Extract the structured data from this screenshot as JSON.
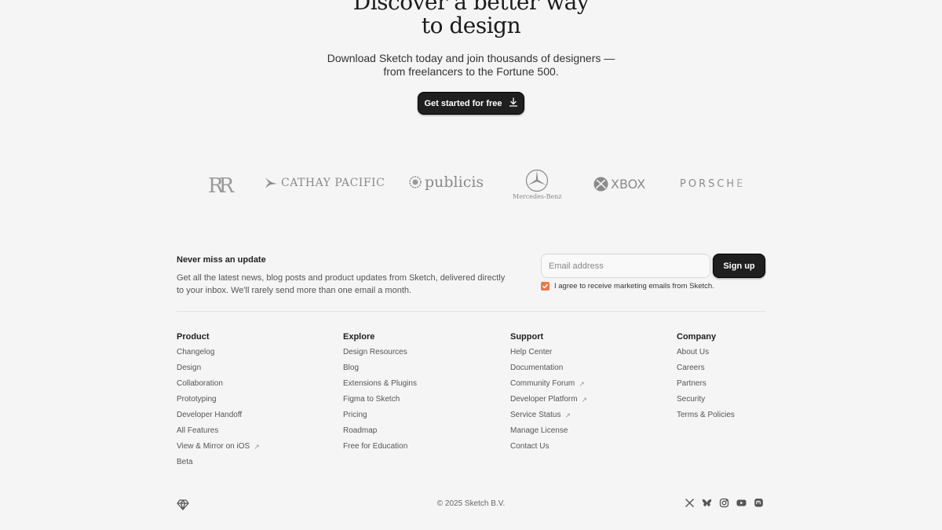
{
  "hero": {
    "title_line1": "Discover a better way",
    "title_line2": "to design",
    "subtitle_line1": "Download Sketch today and join thousands of designers —",
    "subtitle_line2": "from freelancers to the Fortune 500.",
    "cta_label": "Get started for free",
    "cta_icon": "download-icon"
  },
  "logos": {
    "rolls_royce": "RR",
    "cathay": "CATHAY PACIFIC",
    "publicis": "publicis",
    "mercedes": "Mercedes-Benz",
    "xbox": "XBOX",
    "porsche": "PORSCHE"
  },
  "newsletter": {
    "title": "Never miss an update",
    "description": "Get all the latest news, blog posts and product updates from Sketch, delivered directly to your inbox. We'll rarely send more than one email a month.",
    "email_placeholder": "Email address",
    "email_value": "",
    "signup_label": "Sign up",
    "agree_label": "I agree to receive marketing emails from Sketch.",
    "agree_checked": true,
    "accent_color": "#e9784a"
  },
  "footer": {
    "columns": [
      {
        "heading": "Product",
        "links": [
          {
            "label": "Changelog",
            "external": false
          },
          {
            "label": "Design",
            "external": false
          },
          {
            "label": "Collaboration",
            "external": false
          },
          {
            "label": "Prototyping",
            "external": false
          },
          {
            "label": "Developer Handoff",
            "external": false
          },
          {
            "label": "All Features",
            "external": false
          },
          {
            "label": "View & Mirror on iOS",
            "external": true
          },
          {
            "label": "Beta",
            "external": false
          }
        ]
      },
      {
        "heading": "Explore",
        "links": [
          {
            "label": "Design Resources",
            "external": false
          },
          {
            "label": "Blog",
            "external": false
          },
          {
            "label": "Extensions & Plugins",
            "external": false
          },
          {
            "label": "Figma to Sketch",
            "external": false
          },
          {
            "label": "Pricing",
            "external": false
          },
          {
            "label": "Roadmap",
            "external": false
          },
          {
            "label": "Free for Education",
            "external": false
          }
        ]
      },
      {
        "heading": "Support",
        "links": [
          {
            "label": "Help Center",
            "external": false
          },
          {
            "label": "Documentation",
            "external": false
          },
          {
            "label": "Community Forum",
            "external": true
          },
          {
            "label": "Developer Platform",
            "external": true
          },
          {
            "label": "Service Status",
            "external": true
          },
          {
            "label": "Manage License",
            "external": false
          },
          {
            "label": "Contact Us",
            "external": false
          }
        ]
      },
      {
        "heading": "Company",
        "links": [
          {
            "label": "About Us",
            "external": false
          },
          {
            "label": "Careers",
            "external": false
          },
          {
            "label": "Partners",
            "external": false
          },
          {
            "label": "Security",
            "external": false
          },
          {
            "label": "Terms & Policies",
            "external": false
          }
        ]
      }
    ],
    "external_glyph": "↗",
    "copyright": "© 2025 Sketch B.V.",
    "logo_icon": "sketch-diamond-icon",
    "social_icons": [
      "x-icon",
      "bluesky-icon",
      "instagram-icon",
      "youtube-icon",
      "mastodon-icon"
    ]
  }
}
